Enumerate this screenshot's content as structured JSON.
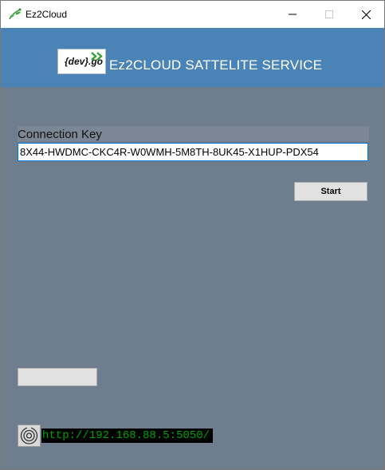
{
  "window": {
    "title": "Ez2Cloud",
    "controls": {
      "minimize": "minimize-icon",
      "maximize": "maximize-icon",
      "close": "close-icon"
    }
  },
  "header": {
    "logo_text": "{dev}.go",
    "title": "Ez2CLOUD SATTELITE SERVICE"
  },
  "form": {
    "connection_key_label": "Connection Key",
    "connection_key_value": "8X44-HWDMC-CKC4R-W0WMH-5M8TH-8UK45-X1HUP-PDX54",
    "start_label": "Start"
  },
  "status": {
    "url": "http://192.168.88.5:5050/"
  },
  "colors": {
    "header_bg": "#4a83b6",
    "client_bg": "#6f7e8e",
    "url_fg": "#00a300",
    "logo_accent": "#3aa33a"
  }
}
